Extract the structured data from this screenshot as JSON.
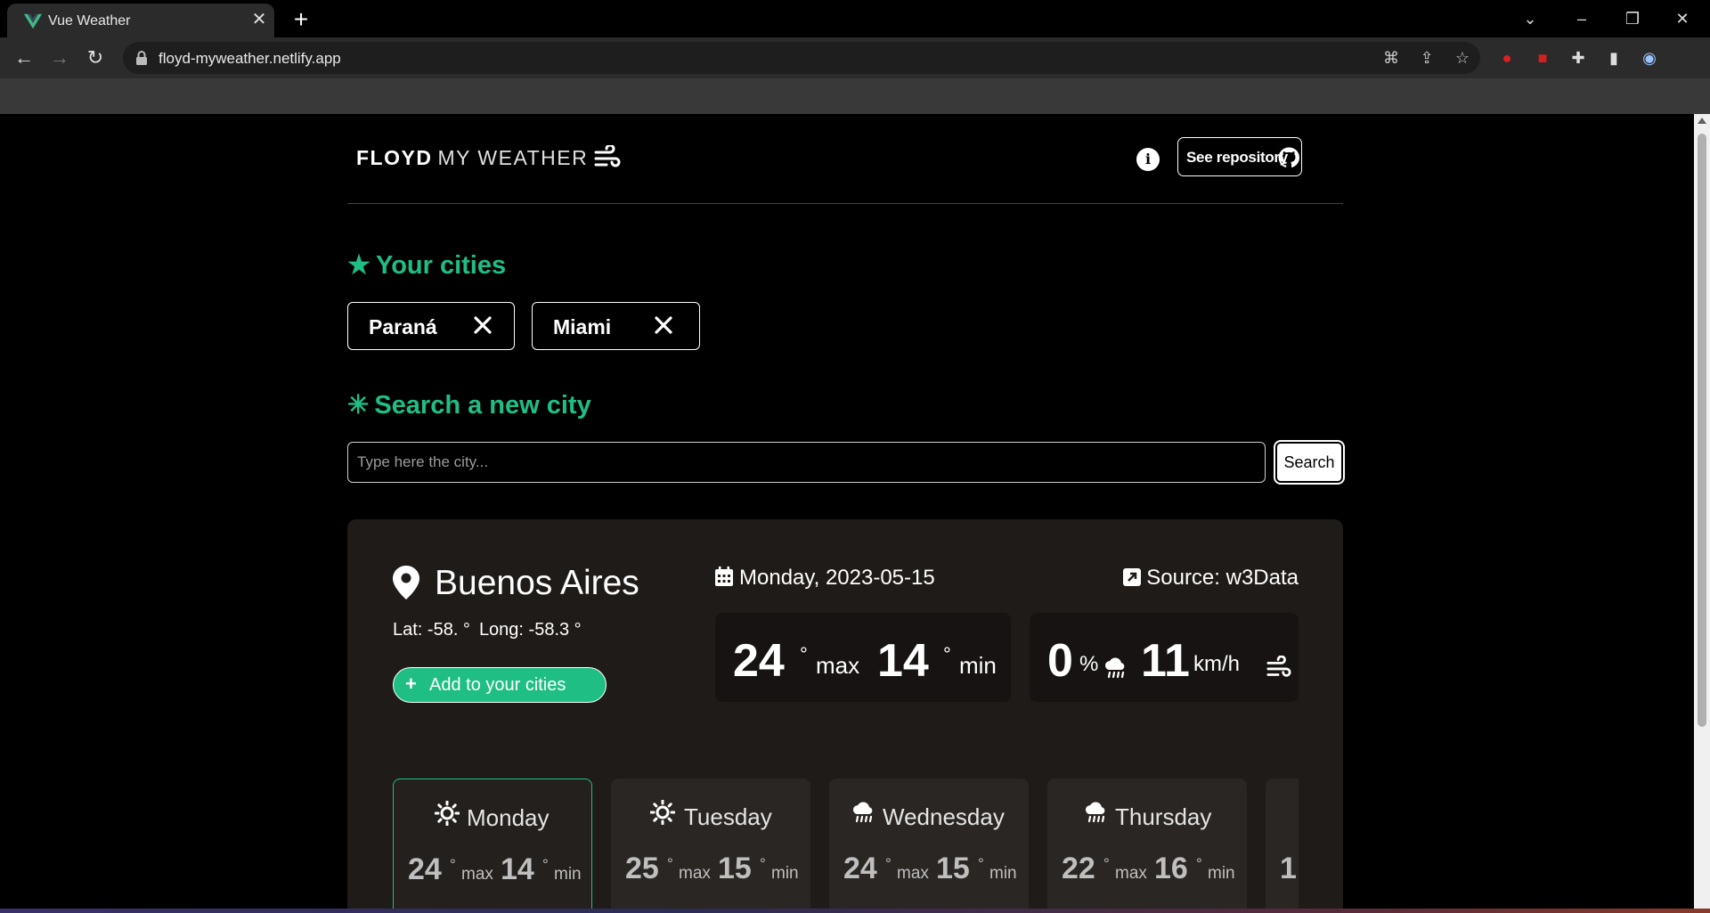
{
  "browser": {
    "tab_title": "Vue Weather",
    "url": "floyd-myweather.netlify.app"
  },
  "header": {
    "brand_strong": "FLOYD",
    "brand_light": "MY WEATHER",
    "repo_button": "See repository"
  },
  "your_cities": {
    "title": "Your cities",
    "cities": [
      "Paraná",
      "Miami"
    ]
  },
  "search": {
    "title": "Search a new city",
    "placeholder": "Type here the city...",
    "button": "Search"
  },
  "weather": {
    "city": "Buenos Aires",
    "lat_label": "Lat: -58. °",
    "long_label": "Long: -58.3 °",
    "add_button": "Add to your cities",
    "date": "Monday, 2023-05-15",
    "source": "Source: w3Data",
    "max": "24",
    "min": "14",
    "max_label": "max",
    "min_label": "min",
    "degree": "°",
    "rain": "0",
    "rain_unit": "%",
    "wind": "11",
    "wind_unit": "km/h",
    "colors": {
      "accent": "#1fbe85",
      "card": "#1f1b18"
    }
  },
  "forecast": [
    {
      "day": "Monday",
      "icon": "sun-icon",
      "max": "24",
      "min": "14"
    },
    {
      "day": "Tuesday",
      "icon": "sun-icon",
      "max": "25",
      "min": "15"
    },
    {
      "day": "Wednesday",
      "icon": "rain-cloud-icon",
      "max": "24",
      "min": "15"
    },
    {
      "day": "Thursday",
      "icon": "rain-cloud-icon",
      "max": "22",
      "min": "16"
    },
    {
      "day": "",
      "icon": "",
      "max": "1",
      "min": ""
    }
  ]
}
